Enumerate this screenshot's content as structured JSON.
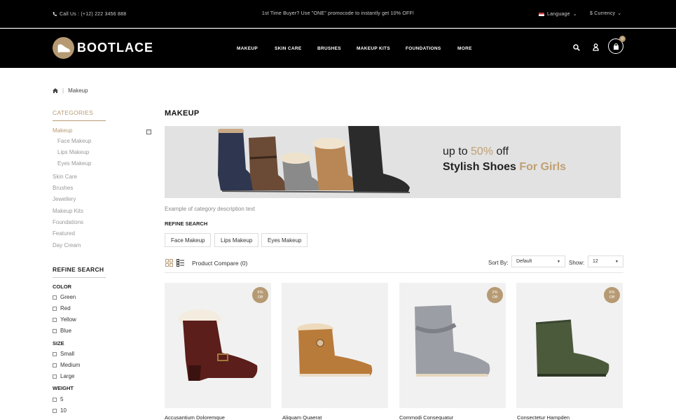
{
  "topbar": {
    "call_text": "Call Us : (+12) 222 3456 888",
    "promo_text": "1st Time Buyer? Use \"ONE\" promocode to instantly get 10% OFF!",
    "language_label": "Language",
    "currency_label": "$ Currency"
  },
  "header": {
    "logo_text": "BOOTLACE",
    "nav": [
      "MAKEUP",
      "SKIN CARE",
      "BRUSHES",
      "MAKEUP KITS",
      "FOUNDATIONS",
      "MORE"
    ],
    "cart_count": "0"
  },
  "breadcrumb": {
    "current": "Makeup"
  },
  "sidebar": {
    "categories_title": "CATEGORIES",
    "categories": [
      "Makeup",
      "Face Makeup",
      "Lips Makeup",
      "Eyes Makeup",
      "Skin Care",
      "Brushes",
      "Jewellery",
      "Makeup Kits",
      "Foundations",
      "Featured",
      "Day Cream"
    ],
    "refine_title": "REFINE SEARCH",
    "color_title": "COLOR",
    "colors": [
      "Green",
      "Red",
      "Yellow",
      "Blue"
    ],
    "size_title": "SIZE",
    "sizes": [
      "Small",
      "Medium",
      "Large"
    ],
    "weight_title": "WEIGHT",
    "weights": [
      "5",
      "10"
    ]
  },
  "main": {
    "title": "MAKEUP",
    "banner_line1_pre": "up to ",
    "banner_line1_highlight": "50%",
    "banner_line1_post": " off",
    "banner_line2_pre": "Stylish Shoes ",
    "banner_line2_highlight": "For Girls",
    "description": "Example of category description text",
    "refine_title": "REFINE SEARCH",
    "chips": [
      "Face Makeup",
      "Lips Makeup",
      "Eyes Makeup"
    ],
    "compare_text": "Product Compare (0)",
    "sort_label": "Sort By:",
    "sort_value": "Default",
    "show_label": "Show:",
    "show_value": "12"
  },
  "products": [
    {
      "name": "Accusantium Doloremque",
      "badge_pct": "6%",
      "badge_off": "Off"
    },
    {
      "name": "Aliquam Quaerat",
      "badge_pct": "",
      "badge_off": ""
    },
    {
      "name": "Commodi Consequatur",
      "badge_pct": "2%",
      "badge_off": "Off"
    },
    {
      "name": "Consectetur Hampden",
      "badge_pct": "6%",
      "badge_off": "Off"
    }
  ],
  "colors": {
    "accent": "#b69a73",
    "topbar": "#000000"
  }
}
